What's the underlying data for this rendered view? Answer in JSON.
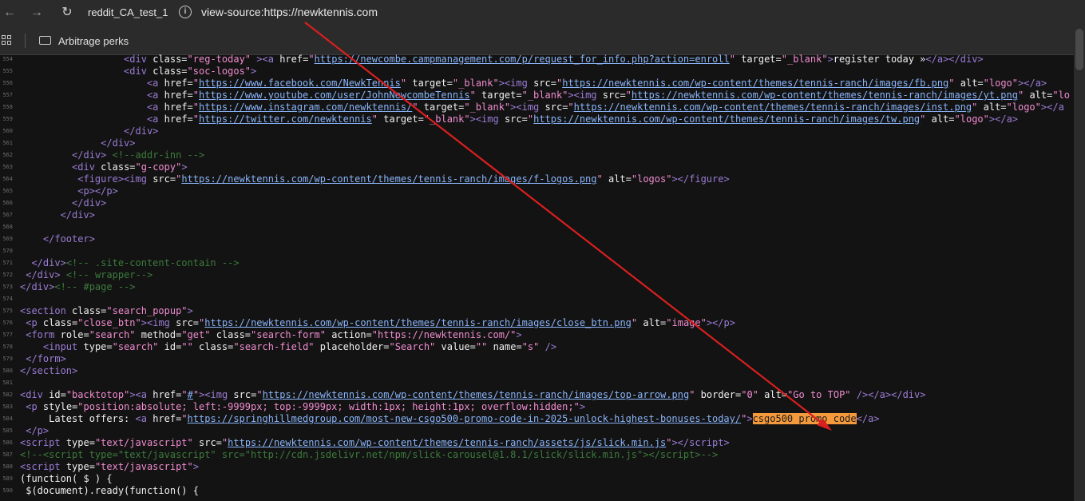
{
  "browser": {
    "tab_title": "reddit_CA_test_1",
    "url": "view-source:https://newktennis.com",
    "bookmark_label": "Arbitrage perks"
  },
  "code_lines": [
    {
      "n": "554",
      "indent": "                  ",
      "html": "<span class=\"t\">&lt;div</span> <span class=\"an\">class=</span><span class=\"av\">\"reg-today\"</span> <span class=\"t\">&gt;&lt;a</span> <span class=\"an\">href=</span><span class=\"av\">\"</span><span class=\"lk\">https://newcombe.campmanagement.com/p/request_for_info.php?action=enroll</span><span class=\"av\">\"</span> <span class=\"an\">target=</span><span class=\"av\">\"_blank\"</span><span class=\"t\">&gt;</span>register today »<span class=\"t\">&lt;/a&gt;&lt;/div&gt;</span>"
    },
    {
      "n": "555",
      "indent": "                  ",
      "html": "<span class=\"t\">&lt;div</span> <span class=\"an\">class=</span><span class=\"av\">\"soc-logos\"</span><span class=\"t\">&gt;</span>"
    },
    {
      "n": "556",
      "indent": "                      ",
      "html": "<span class=\"t\">&lt;a</span> <span class=\"an\">href=</span><span class=\"av\">\"</span><span class=\"lk\">https://www.facebook.com/NewkTennis</span><span class=\"av\">\"</span> <span class=\"an\">target=</span><span class=\"av\">\"_blank\"</span><span class=\"t\">&gt;&lt;img</span> <span class=\"an\">src=</span><span class=\"av\">\"</span><span class=\"lk\">https://newktennis.com/wp-content/themes/tennis-ranch/images/fb.png</span><span class=\"av\">\"</span> <span class=\"an\">alt=</span><span class=\"av\">\"logo\"</span><span class=\"t\">&gt;&lt;/a&gt;</span>"
    },
    {
      "n": "557",
      "indent": "                      ",
      "html": "<span class=\"t\">&lt;a</span> <span class=\"an\">href=</span><span class=\"av\">\"</span><span class=\"lk\">https://www.youtube.com/user/JohnNewcombeTennis</span><span class=\"av\">\"</span> <span class=\"an\">target=</span><span class=\"av\">\"_blank\"</span><span class=\"t\">&gt;&lt;img</span> <span class=\"an\">src=</span><span class=\"av\">\"</span><span class=\"lk\">https://newktennis.com/wp-content/themes/tennis-ranch/images/yt.png</span><span class=\"av\">\"</span> <span class=\"an\">alt=</span><span class=\"av\">\"lo</span>"
    },
    {
      "n": "558",
      "indent": "                      ",
      "html": "<span class=\"t\">&lt;a</span> <span class=\"an\">href=</span><span class=\"av\">\"</span><span class=\"lk\">https://www.instagram.com/newktennis/</span><span class=\"av\">\"</span> <span class=\"an\">target=</span><span class=\"av\">\"_blank\"</span><span class=\"t\">&gt;&lt;img</span> <span class=\"an\">src=</span><span class=\"av\">\"</span><span class=\"lk\">https://newktennis.com/wp-content/themes/tennis-ranch/images/inst.png</span><span class=\"av\">\"</span> <span class=\"an\">alt=</span><span class=\"av\">\"logo\"</span><span class=\"t\">&gt;&lt;/a</span>"
    },
    {
      "n": "559",
      "indent": "                      ",
      "html": "<span class=\"t\">&lt;a</span> <span class=\"an\">href=</span><span class=\"av\">\"</span><span class=\"lk\">https://twitter.com/newktennis</span><span class=\"av\">\"</span> <span class=\"an\">target=</span><span class=\"av\">\"_blank\"</span><span class=\"t\">&gt;&lt;img</span> <span class=\"an\">src=</span><span class=\"av\">\"</span><span class=\"lk\">https://newktennis.com/wp-content/themes/tennis-ranch/images/tw.png</span><span class=\"av\">\"</span> <span class=\"an\">alt=</span><span class=\"av\">\"logo\"</span><span class=\"t\">&gt;&lt;/a&gt;</span>"
    },
    {
      "n": "560",
      "indent": "                  ",
      "html": "<span class=\"t\">&lt;/div&gt;</span>"
    },
    {
      "n": "561",
      "indent": "              ",
      "html": "<span class=\"t\">&lt;/div&gt;</span>"
    },
    {
      "n": "562",
      "indent": "         ",
      "html": "<span class=\"t\">&lt;/div&gt;</span> <span class=\"cm\">&lt;!--addr-inn --&gt;</span>"
    },
    {
      "n": "563",
      "indent": "         ",
      "html": "<span class=\"t\">&lt;div</span> <span class=\"an\">class=</span><span class=\"av\">\"g-copy\"</span><span class=\"t\">&gt;</span>"
    },
    {
      "n": "564",
      "indent": "          ",
      "html": "<span class=\"t\">&lt;figure&gt;&lt;img</span> <span class=\"an\">src=</span><span class=\"av\">\"</span><span class=\"lk\">https://newktennis.com/wp-content/themes/tennis-ranch/images/f-logos.png</span><span class=\"av\">\"</span> <span class=\"an\">alt=</span><span class=\"av\">\"logos\"</span><span class=\"t\">&gt;&lt;/figure&gt;</span>"
    },
    {
      "n": "565",
      "indent": "          ",
      "html": "<span class=\"t\">&lt;p&gt;&lt;/p&gt;</span>"
    },
    {
      "n": "566",
      "indent": "         ",
      "html": "<span class=\"t\">&lt;/div&gt;</span>"
    },
    {
      "n": "567",
      "indent": "       ",
      "html": "<span class=\"t\">&lt;/div&gt;</span>"
    },
    {
      "n": "568",
      "indent": "",
      "html": ""
    },
    {
      "n": "569",
      "indent": "    ",
      "html": "<span class=\"t\">&lt;/footer&gt;</span>"
    },
    {
      "n": "570",
      "indent": "",
      "html": ""
    },
    {
      "n": "571",
      "indent": "  ",
      "html": "<span class=\"t\">&lt;/div&gt;</span><span class=\"cm\">&lt;!-- .site-content-contain --&gt;</span>"
    },
    {
      "n": "572",
      "indent": " ",
      "html": "<span class=\"t\">&lt;/div&gt;</span> <span class=\"cm\">&lt;!-- wrapper--&gt;</span>"
    },
    {
      "n": "573",
      "indent": "",
      "html": "<span class=\"t\">&lt;/div&gt;</span><span class=\"cm\">&lt;!-- #page --&gt;</span>"
    },
    {
      "n": "574",
      "indent": "",
      "html": ""
    },
    {
      "n": "575",
      "indent": "",
      "html": "<span class=\"t\">&lt;section</span> <span class=\"an\">class=</span><span class=\"av\">\"search_popup\"</span><span class=\"t\">&gt;</span>"
    },
    {
      "n": "576",
      "indent": " ",
      "html": "<span class=\"t\">&lt;p</span> <span class=\"an\">class=</span><span class=\"av\">\"close_btn\"</span><span class=\"t\">&gt;&lt;img</span> <span class=\"an\">src=</span><span class=\"av\">\"</span><span class=\"lk\">https://newktennis.com/wp-content/themes/tennis-ranch/images/close_btn.png</span><span class=\"av\">\"</span> <span class=\"an\">alt=</span><span class=\"av\">\"image\"</span><span class=\"t\">&gt;&lt;/p&gt;</span>"
    },
    {
      "n": "577",
      "indent": " ",
      "html": "<span class=\"t\">&lt;form</span> <span class=\"an\">role=</span><span class=\"av\">\"search\"</span> <span class=\"an\">method=</span><span class=\"av\">\"get\"</span> <span class=\"an\">class=</span><span class=\"av\">\"search-form\"</span> <span class=\"an\">action=</span><span class=\"av\">\"https://newktennis.com/\"</span><span class=\"t\">&gt;</span>"
    },
    {
      "n": "578",
      "indent": "    ",
      "html": "<span class=\"t\">&lt;input</span> <span class=\"an\">type=</span><span class=\"av\">\"search\"</span> <span class=\"an\">id=</span><span class=\"av\">\"\"</span> <span class=\"an\">class=</span><span class=\"av\">\"search-field\"</span> <span class=\"an\">placeholder=</span><span class=\"av\">\"Search\"</span> <span class=\"an\">value=</span><span class=\"av\">\"\"</span> <span class=\"an\">name=</span><span class=\"av\">\"s\"</span> <span class=\"t\">/&gt;</span>"
    },
    {
      "n": "579",
      "indent": " ",
      "html": "<span class=\"t\">&lt;/form&gt;</span>"
    },
    {
      "n": "580",
      "indent": "",
      "html": "<span class=\"t\">&lt;/section&gt;</span>"
    },
    {
      "n": "581",
      "indent": "",
      "html": ""
    },
    {
      "n": "582",
      "indent": "",
      "html": "<span class=\"t\">&lt;div</span> <span class=\"an\">id=</span><span class=\"av\">\"backtotop\"</span><span class=\"t\">&gt;&lt;a</span> <span class=\"an\">href=</span><span class=\"av\">\"</span><span class=\"lk\">#</span><span class=\"av\">\"</span><span class=\"t\">&gt;&lt;img</span> <span class=\"an\">src=</span><span class=\"av\">\"</span><span class=\"lk\">https://newktennis.com/wp-content/themes/tennis-ranch/images/top-arrow.png</span><span class=\"av\">\"</span> <span class=\"an\">border=</span><span class=\"av\">\"0\"</span> <span class=\"an\">alt=</span><span class=\"av\">\"Go to TOP\"</span> <span class=\"t\">/&gt;&lt;/a&gt;&lt;/div&gt;</span>"
    },
    {
      "n": "583",
      "indent": " ",
      "html": "<span class=\"t\">&lt;p</span> <span class=\"an\">style=</span><span class=\"av\">\"position:absolute; left:-9999px; top:-9999px; width:1px; height:1px; overflow:hidden;\"</span><span class=\"t\">&gt;</span>"
    },
    {
      "n": "584",
      "indent": "     ",
      "html": "Latest offers: <span class=\"t\">&lt;a</span> <span class=\"an\">href=</span><span class=\"av\">\"</span><span class=\"lk\">https://springhillmedgroup.com/most-new-csgo500-promo-code-in-2025-unlock-highest-bonuses-today/</span><span class=\"av\">\"</span><span class=\"t\">&gt;</span><span class=\"hl\">csgo500 promo code</span><span class=\"t\">&lt;/a&gt;</span>"
    },
    {
      "n": "585",
      "indent": " ",
      "html": "<span class=\"t\">&lt;/p&gt;</span>"
    },
    {
      "n": "586",
      "indent": "",
      "html": "<span class=\"t\">&lt;script</span> <span class=\"an\">type=</span><span class=\"av\">\"text/javascript\"</span> <span class=\"an\">src=</span><span class=\"av\">\"</span><span class=\"lk\">https://newktennis.com/wp-content/themes/tennis-ranch/assets/js/slick.min.js</span><span class=\"av\">\"</span><span class=\"t\">&gt;&lt;/script&gt;</span>"
    },
    {
      "n": "587",
      "indent": "",
      "html": "<span class=\"cm\">&lt;!--&lt;script type=\"text/javascript\" src=\"http://cdn.jsdelivr.net/npm/slick-carousel@1.8.1/slick/slick.min.js\"&gt;&lt;/script&gt;--&gt;</span>"
    },
    {
      "n": "588",
      "indent": "",
      "html": "<span class=\"t\">&lt;script</span> <span class=\"an\">type=</span><span class=\"av\">\"text/javascript\"</span><span class=\"t\">&gt;</span>"
    },
    {
      "n": "589",
      "indent": "",
      "html": "(function( $ ) {"
    },
    {
      "n": "590",
      "indent": " ",
      "html": "$(document).ready(function() {"
    }
  ]
}
